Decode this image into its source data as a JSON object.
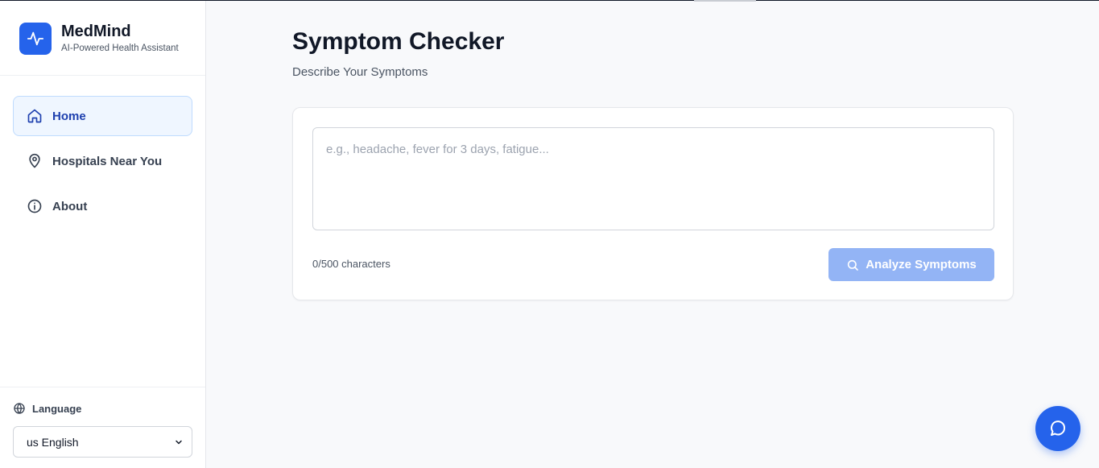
{
  "brand": {
    "name": "MedMind",
    "tagline": "AI-Powered Health Assistant",
    "logo_icon": "activity-pulse-icon",
    "color": "#2563eb"
  },
  "nav": {
    "items": [
      {
        "label": "Home",
        "icon": "home-icon",
        "active": true
      },
      {
        "label": "Hospitals Near You",
        "icon": "map-pin-icon",
        "active": false
      },
      {
        "label": "About",
        "icon": "info-icon",
        "active": false
      }
    ]
  },
  "language": {
    "label": "Language",
    "icon": "globe-icon",
    "selected": "us English"
  },
  "page": {
    "title": "Symptom Checker",
    "subtitle": "Describe Your Symptoms"
  },
  "symptom_form": {
    "value": "",
    "placeholder": "e.g., headache, fever for 3 days, fatigue...",
    "char_count": "0/500 characters",
    "submit_label": "Analyze Symptoms",
    "submit_icon": "search-icon",
    "submit_color": "#93b4f5"
  },
  "chat": {
    "icon": "chat-bubble-icon"
  }
}
